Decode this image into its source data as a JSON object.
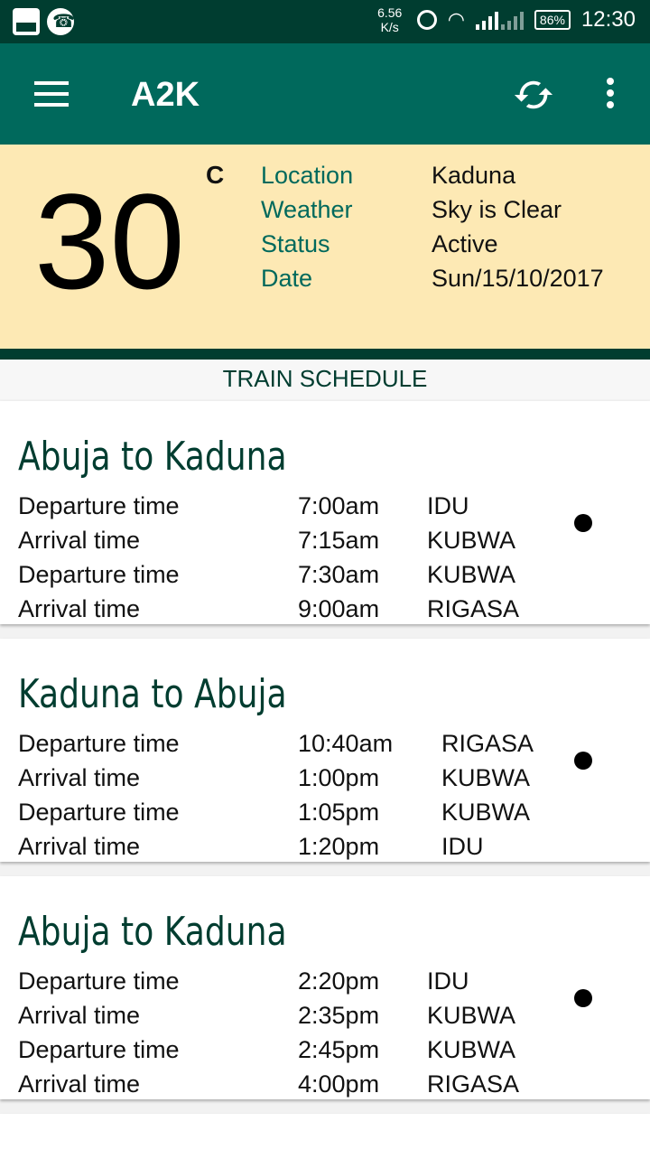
{
  "status_bar": {
    "speed_value": "6.56",
    "speed_unit": "K/s",
    "battery": "86%",
    "time": "12:30"
  },
  "app_bar": {
    "title": "A2K"
  },
  "weather": {
    "temperature": "30",
    "unit": "C",
    "labels": [
      "Location",
      "Weather",
      "Status",
      "Date"
    ],
    "values": [
      "Kaduna",
      "Sky is Clear",
      "Active",
      "Sun/15/10/2017"
    ]
  },
  "section_title": "TRAIN SCHEDULE",
  "schedules": [
    {
      "title": "Abuja to Kaduna",
      "rows": [
        {
          "label": "Departure time",
          "time": "7:00am",
          "station": "IDU"
        },
        {
          "label": "Arrival time",
          "time": "7:15am",
          "station": "KUBWA"
        },
        {
          "label": "Departure time",
          "time": "7:30am",
          "station": "KUBWA"
        },
        {
          "label": "Arrival time",
          "time": "9:00am",
          "station": "RIGASA"
        }
      ]
    },
    {
      "title": "Kaduna to Abuja",
      "rows": [
        {
          "label": "Departure time",
          "time": "10:40am",
          "station": "RIGASA"
        },
        {
          "label": "Arrival time",
          "time": "1:00pm",
          "station": "KUBWA"
        },
        {
          "label": "Departure time",
          "time": "1:05pm",
          "station": "KUBWA"
        },
        {
          "label": "Arrival time",
          "time": "1:20pm",
          "station": "IDU"
        }
      ]
    },
    {
      "title": "Abuja to Kaduna",
      "rows": [
        {
          "label": "Departure time",
          "time": "2:20pm",
          "station": "IDU"
        },
        {
          "label": "Arrival time",
          "time": "2:35pm",
          "station": "KUBWA"
        },
        {
          "label": "Departure time",
          "time": "2:45pm",
          "station": "KUBWA"
        },
        {
          "label": "Arrival time",
          "time": "4:00pm",
          "station": "RIGASA"
        }
      ]
    }
  ]
}
